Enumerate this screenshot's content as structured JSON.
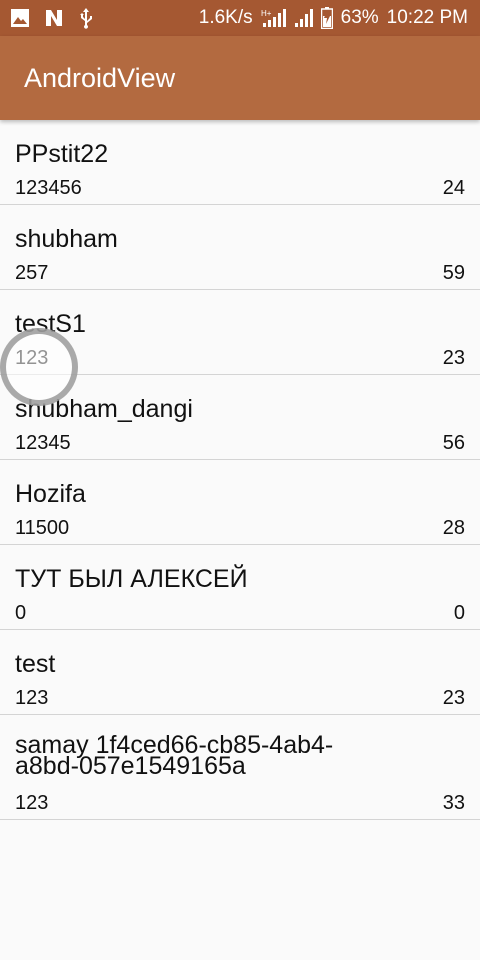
{
  "status_bar": {
    "net_speed": "1.6K/s",
    "battery": "63%",
    "time": "10:22 PM",
    "icons": [
      "image-icon",
      "n-app-icon",
      "usb-icon",
      "hplus-signal-icon",
      "signal-icon",
      "battery-icon"
    ]
  },
  "toolbar": {
    "title": "AndroidView"
  },
  "list": {
    "items": [
      {
        "name": "PPstit22",
        "sub": "123456",
        "value": "24"
      },
      {
        "name": "shubham",
        "sub": "257",
        "value": "59"
      },
      {
        "name": "testS1",
        "sub": "123",
        "value": "23"
      },
      {
        "name": "shubham_dangi",
        "sub": "12345",
        "value": "56"
      },
      {
        "name": "Hozifa",
        "sub": "11500",
        "value": "28"
      },
      {
        "name": "ТУТ БЫЛ АЛЕКСЕЙ",
        "sub": "0",
        "value": "0"
      },
      {
        "name": "test",
        "sub": "123",
        "value": "23"
      },
      {
        "name": "samay 1f4ced66-cb85-4ab4-a8bd-057e1549165a",
        "sub": "123",
        "value": "33"
      }
    ]
  },
  "colors": {
    "status_bar": "#a55832",
    "toolbar": "#b36a40",
    "background": "#fafafa"
  }
}
